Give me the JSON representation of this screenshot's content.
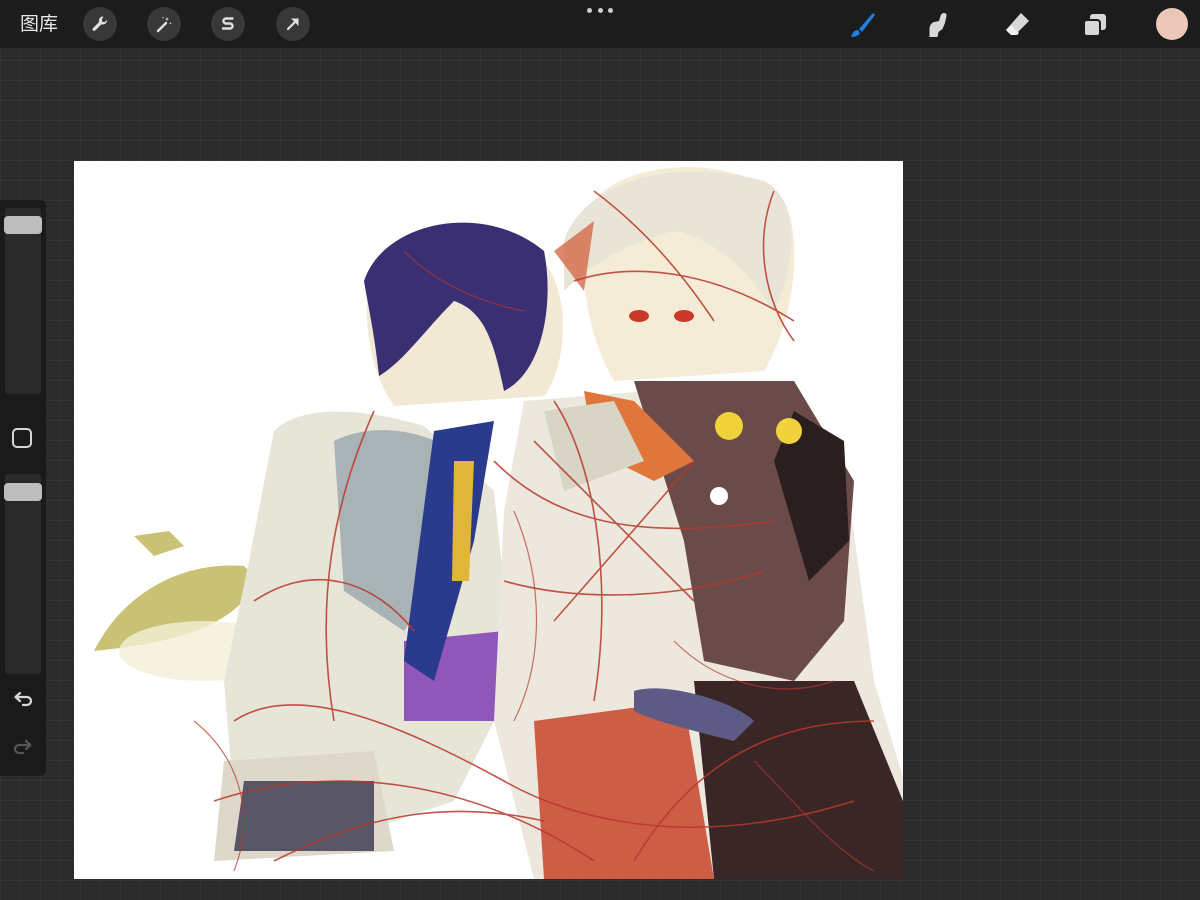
{
  "topbar": {
    "gallery_label": "图库",
    "left_tools": [
      {
        "name": "actions-wrench-icon"
      },
      {
        "name": "adjustments-magic-wand-icon"
      },
      {
        "name": "selection-icon"
      },
      {
        "name": "transform-arrow-icon"
      }
    ],
    "right_tools": [
      {
        "name": "brush-icon",
        "active": true
      },
      {
        "name": "smudge-icon"
      },
      {
        "name": "eraser-icon"
      },
      {
        "name": "layers-icon"
      }
    ],
    "current_color": "#eac7b8",
    "accent_color": "#1f7ee6"
  },
  "sidebar": {
    "brush_size_level": 0.05,
    "opacity_level": 0.05,
    "modify_button": "square-modify-icon",
    "undo": "undo-arrow-icon",
    "redo": "redo-arrow-icon"
  },
  "canvas": {
    "background": "#ffffff"
  }
}
